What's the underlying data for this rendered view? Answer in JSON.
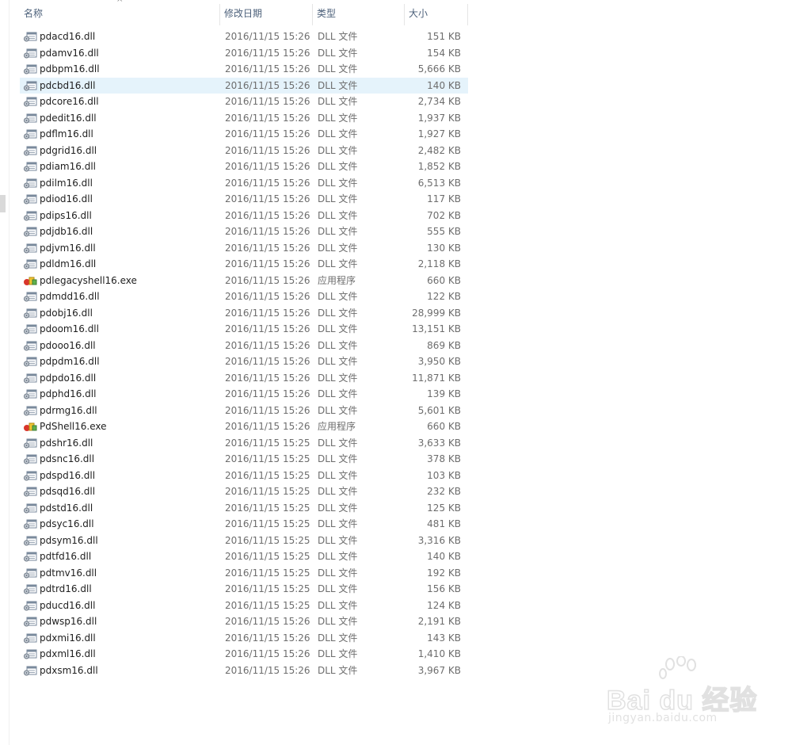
{
  "header": {
    "name_label": "名称",
    "date_label": "修改日期",
    "type_label": "类型",
    "size_label": "大小",
    "sort_indicator": "^"
  },
  "files": [
    {
      "name": "pdacd16.dll",
      "date": "2016/11/15 15:26",
      "type": "DLL 文件",
      "size": "151 KB",
      "icon": "dll-file-icon"
    },
    {
      "name": "pdamv16.dll",
      "date": "2016/11/15 15:26",
      "type": "DLL 文件",
      "size": "154 KB",
      "icon": "dll-file-icon"
    },
    {
      "name": "pdbpm16.dll",
      "date": "2016/11/15 15:26",
      "type": "DLL 文件",
      "size": "5,666 KB",
      "icon": "dll-file-icon"
    },
    {
      "name": "pdcbd16.dll",
      "date": "2016/11/15 15:26",
      "type": "DLL 文件",
      "size": "140 KB",
      "icon": "dll-file-icon",
      "selected": true
    },
    {
      "name": "pdcore16.dll",
      "date": "2016/11/15 15:26",
      "type": "DLL 文件",
      "size": "2,734 KB",
      "icon": "dll-file-icon"
    },
    {
      "name": "pdedit16.dll",
      "date": "2016/11/15 15:26",
      "type": "DLL 文件",
      "size": "1,937 KB",
      "icon": "dll-file-icon"
    },
    {
      "name": "pdflm16.dll",
      "date": "2016/11/15 15:26",
      "type": "DLL 文件",
      "size": "1,927 KB",
      "icon": "dll-file-icon"
    },
    {
      "name": "pdgrid16.dll",
      "date": "2016/11/15 15:26",
      "type": "DLL 文件",
      "size": "2,482 KB",
      "icon": "dll-file-icon"
    },
    {
      "name": "pdiam16.dll",
      "date": "2016/11/15 15:26",
      "type": "DLL 文件",
      "size": "1,852 KB",
      "icon": "dll-file-icon"
    },
    {
      "name": "pdilm16.dll",
      "date": "2016/11/15 15:26",
      "type": "DLL 文件",
      "size": "6,513 KB",
      "icon": "dll-file-icon"
    },
    {
      "name": "pdiod16.dll",
      "date": "2016/11/15 15:26",
      "type": "DLL 文件",
      "size": "117 KB",
      "icon": "dll-file-icon"
    },
    {
      "name": "pdips16.dll",
      "date": "2016/11/15 15:26",
      "type": "DLL 文件",
      "size": "702 KB",
      "icon": "dll-file-icon"
    },
    {
      "name": "pdjdb16.dll",
      "date": "2016/11/15 15:26",
      "type": "DLL 文件",
      "size": "555 KB",
      "icon": "dll-file-icon"
    },
    {
      "name": "pdjvm16.dll",
      "date": "2016/11/15 15:26",
      "type": "DLL 文件",
      "size": "130 KB",
      "icon": "dll-file-icon"
    },
    {
      "name": "pdldm16.dll",
      "date": "2016/11/15 15:26",
      "type": "DLL 文件",
      "size": "2,118 KB",
      "icon": "dll-file-icon"
    },
    {
      "name": "pdlegacyshell16.exe",
      "date": "2016/11/15 15:26",
      "type": "应用程序",
      "size": "660 KB",
      "icon": "exe-app-icon"
    },
    {
      "name": "pdmdd16.dll",
      "date": "2016/11/15 15:26",
      "type": "DLL 文件",
      "size": "122 KB",
      "icon": "dll-file-icon"
    },
    {
      "name": "pdobj16.dll",
      "date": "2016/11/15 15:26",
      "type": "DLL 文件",
      "size": "28,999 KB",
      "icon": "dll-file-icon"
    },
    {
      "name": "pdoom16.dll",
      "date": "2016/11/15 15:26",
      "type": "DLL 文件",
      "size": "13,151 KB",
      "icon": "dll-file-icon"
    },
    {
      "name": "pdooo16.dll",
      "date": "2016/11/15 15:26",
      "type": "DLL 文件",
      "size": "869 KB",
      "icon": "dll-file-icon"
    },
    {
      "name": "pdpdm16.dll",
      "date": "2016/11/15 15:26",
      "type": "DLL 文件",
      "size": "3,950 KB",
      "icon": "dll-file-icon"
    },
    {
      "name": "pdpdo16.dll",
      "date": "2016/11/15 15:26",
      "type": "DLL 文件",
      "size": "11,871 KB",
      "icon": "dll-file-icon"
    },
    {
      "name": "pdphd16.dll",
      "date": "2016/11/15 15:26",
      "type": "DLL 文件",
      "size": "139 KB",
      "icon": "dll-file-icon"
    },
    {
      "name": "pdrmg16.dll",
      "date": "2016/11/15 15:26",
      "type": "DLL 文件",
      "size": "5,601 KB",
      "icon": "dll-file-icon"
    },
    {
      "name": "PdShell16.exe",
      "date": "2016/11/15 15:26",
      "type": "应用程序",
      "size": "660 KB",
      "icon": "exe-app-icon"
    },
    {
      "name": "pdshr16.dll",
      "date": "2016/11/15 15:25",
      "type": "DLL 文件",
      "size": "3,633 KB",
      "icon": "dll-file-icon"
    },
    {
      "name": "pdsnc16.dll",
      "date": "2016/11/15 15:25",
      "type": "DLL 文件",
      "size": "378 KB",
      "icon": "dll-file-icon"
    },
    {
      "name": "pdspd16.dll",
      "date": "2016/11/15 15:25",
      "type": "DLL 文件",
      "size": "103 KB",
      "icon": "dll-file-icon"
    },
    {
      "name": "pdsqd16.dll",
      "date": "2016/11/15 15:25",
      "type": "DLL 文件",
      "size": "232 KB",
      "icon": "dll-file-icon"
    },
    {
      "name": "pdstd16.dll",
      "date": "2016/11/15 15:25",
      "type": "DLL 文件",
      "size": "125 KB",
      "icon": "dll-file-icon"
    },
    {
      "name": "pdsyc16.dll",
      "date": "2016/11/15 15:25",
      "type": "DLL 文件",
      "size": "481 KB",
      "icon": "dll-file-icon"
    },
    {
      "name": "pdsym16.dll",
      "date": "2016/11/15 15:25",
      "type": "DLL 文件",
      "size": "3,316 KB",
      "icon": "dll-file-icon"
    },
    {
      "name": "pdtfd16.dll",
      "date": "2016/11/15 15:25",
      "type": "DLL 文件",
      "size": "140 KB",
      "icon": "dll-file-icon"
    },
    {
      "name": "pdtmv16.dll",
      "date": "2016/11/15 15:25",
      "type": "DLL 文件",
      "size": "192 KB",
      "icon": "dll-file-icon"
    },
    {
      "name": "pdtrd16.dll",
      "date": "2016/11/15 15:25",
      "type": "DLL 文件",
      "size": "156 KB",
      "icon": "dll-file-icon"
    },
    {
      "name": "pducd16.dll",
      "date": "2016/11/15 15:25",
      "type": "DLL 文件",
      "size": "124 KB",
      "icon": "dll-file-icon"
    },
    {
      "name": "pdwsp16.dll",
      "date": "2016/11/15 15:26",
      "type": "DLL 文件",
      "size": "2,191 KB",
      "icon": "dll-file-icon"
    },
    {
      "name": "pdxmi16.dll",
      "date": "2016/11/15 15:26",
      "type": "DLL 文件",
      "size": "143 KB",
      "icon": "dll-file-icon"
    },
    {
      "name": "pdxml16.dll",
      "date": "2016/11/15 15:26",
      "type": "DLL 文件",
      "size": "1,410 KB",
      "icon": "dll-file-icon"
    },
    {
      "name": "pdxsm16.dll",
      "date": "2016/11/15 15:26",
      "type": "DLL 文件",
      "size": "3,967 KB",
      "icon": "dll-file-icon"
    }
  ],
  "watermark": {
    "brand": "Bai du 经验",
    "url": "jingyan.baidu.com"
  },
  "colors": {
    "header_text": "#4c607a",
    "selected_row": "#e5f3fb",
    "secondary_text": "#6d6d6d"
  }
}
